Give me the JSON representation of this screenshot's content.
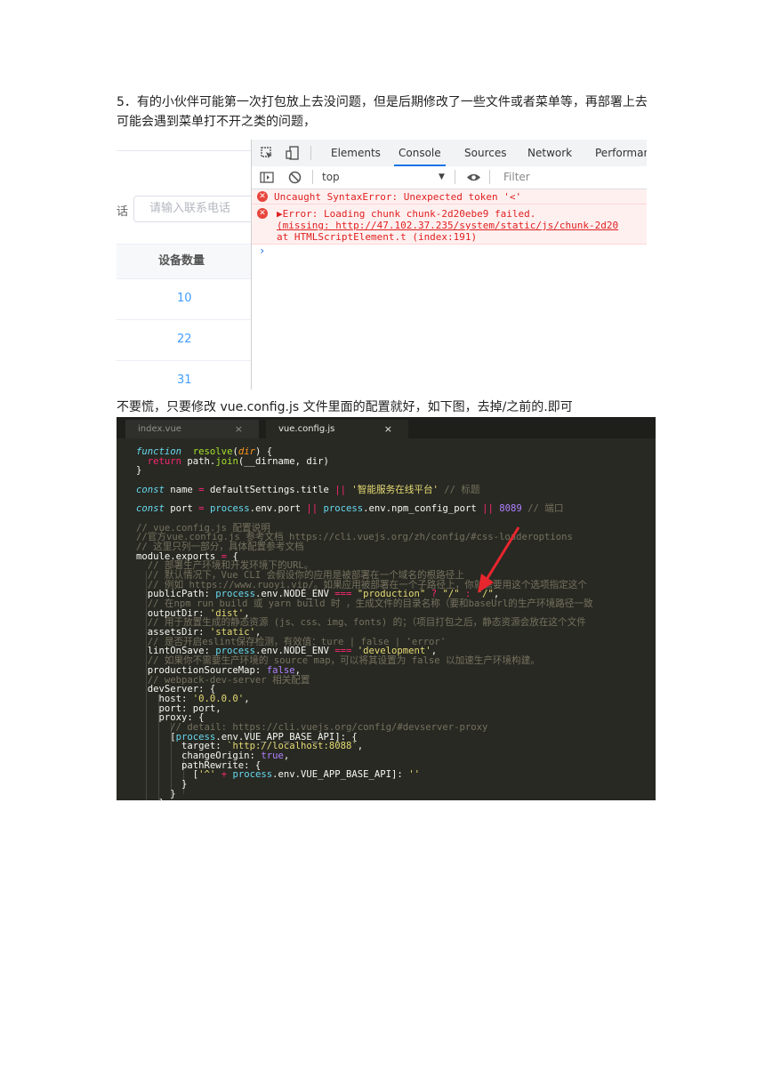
{
  "paragraphs": {
    "p1": "5．有的小伙伴可能第一次打包放上去没问题，但是后期修改了一些文件或者菜单等，再部署上去可能会遇到菜单打不开之类的问题，",
    "p2": "不要慌，只要修改 vue.config.js 文件里面的配置就好，如下图，去掉/之前的.即可"
  },
  "screenshot1": {
    "left_panel": {
      "cut_label_char": "话",
      "phone_input_placeholder": "请输入联系电话",
      "table_header": "设备数量",
      "rows": [
        "10",
        "22",
        "31"
      ]
    },
    "devtools": {
      "tabs": [
        "Elements",
        "Console",
        "Sources",
        "Network",
        "Performan"
      ],
      "active_tab": "Console",
      "context_select": "top",
      "filter_placeholder": "Filter",
      "errors": [
        {
          "lines": [
            "Uncaught SyntaxError: Unexpected token '<'"
          ]
        },
        {
          "lines": [
            "▶Error: Loading chunk chunk-2d20ebe9 failed.",
            "(missing: http://47.102.37.235/system/static/js/chunk-2d20",
            "    at HTMLScriptElement.t (index:191)"
          ]
        }
      ],
      "prompt": "›"
    }
  },
  "screenshot2": {
    "tabs": [
      {
        "name": "index.vue",
        "close": "×"
      },
      {
        "name": "vue.config.js",
        "close": "×"
      }
    ],
    "code_lines": [
      [
        [
          "kw",
          "function"
        ],
        [
          "",
          "  "
        ],
        [
          "fn",
          "resolve"
        ],
        [
          "",
          "("
        ],
        [
          "par",
          "dir"
        ],
        [
          "",
          ") {"
        ]
      ],
      [
        [
          "",
          "  "
        ],
        [
          "op",
          "return"
        ],
        [
          "",
          " path."
        ],
        [
          "fn",
          "join"
        ],
        [
          "",
          "(__dirname, dir)"
        ]
      ],
      [
        [
          "",
          "}"
        ]
      ],
      [
        [
          "",
          ""
        ]
      ],
      [
        [
          "kw",
          "const"
        ],
        [
          "",
          " name "
        ],
        [
          "op",
          "="
        ],
        [
          "",
          " defaultSettings.title "
        ],
        [
          "op",
          "||"
        ],
        [
          "str",
          " '智能服务在线平台'"
        ],
        [
          "cmt",
          " // 标题"
        ]
      ],
      [
        [
          "",
          ""
        ]
      ],
      [
        [
          "kw",
          "const"
        ],
        [
          "",
          " port "
        ],
        [
          "op",
          "="
        ],
        [
          "cyn",
          " process"
        ],
        [
          "",
          ".env.port "
        ],
        [
          "op",
          "||"
        ],
        [
          "cyn",
          " process"
        ],
        [
          "",
          ".env.npm_config_port "
        ],
        [
          "op",
          "||"
        ],
        [
          "num",
          " 8089"
        ],
        [
          "cmt",
          " // 端口"
        ]
      ],
      [
        [
          "",
          ""
        ]
      ],
      [
        [
          "cmt",
          "// vue.config.js 配置说明"
        ]
      ],
      [
        [
          "cmt",
          "//官方vue.config.js 参考文档 https://cli.vuejs.org/zh/config/#css-loaderoptions"
        ]
      ],
      [
        [
          "cmt",
          "// 这里只列一部分，具体配置参考文档"
        ]
      ],
      [
        [
          "",
          "module.exports "
        ],
        [
          "op",
          "="
        ],
        [
          "",
          " {"
        ]
      ],
      [
        [
          "cmt",
          "  // 部署生产环境和开发环境下的URL。"
        ]
      ],
      [
        [
          "cmt",
          "  // 默认情况下，Vue CLI 会假设你的应用是被部署在一个域名的根路径上"
        ]
      ],
      [
        [
          "cmt",
          "  // 例如 https://www.ruoyi.vip/。如果应用被部署在一个子路径上，你就需要用这个选项指定这个"
        ]
      ],
      [
        [
          "",
          "  publicPath: "
        ],
        [
          "cyn",
          "process"
        ],
        [
          "",
          ".env.NODE_ENV "
        ],
        [
          "op",
          "==="
        ],
        [
          "str",
          " \"production\""
        ],
        [
          "op",
          " ?"
        ],
        [
          "str",
          " \"/\""
        ],
        [
          "op",
          " :"
        ],
        [
          "str",
          " \"/\""
        ],
        [
          "",
          ","
        ]
      ],
      [
        [
          "cmt",
          "  // 在npm run build 或 yarn build 时 ，生成文件的目录名称（要和baseUrl的生产环境路径一致"
        ]
      ],
      [
        [
          "",
          "  outputDir: "
        ],
        [
          "str",
          "'dist'"
        ],
        [
          "",
          ","
        ]
      ],
      [
        [
          "cmt",
          "  // 用于放置生成的静态资源 (js、css、img、fonts) 的；（项目打包之后，静态资源会放在这个文件"
        ]
      ],
      [
        [
          "",
          "  assetsDir: "
        ],
        [
          "str",
          "'static'"
        ],
        [
          "",
          ","
        ]
      ],
      [
        [
          "cmt",
          "  // 是否开启eslint保存检测，有效值：ture | false | 'error'"
        ]
      ],
      [
        [
          "",
          "  lintOnSave: "
        ],
        [
          "cyn",
          "process"
        ],
        [
          "",
          ".env.NODE_ENV "
        ],
        [
          "op",
          "==="
        ],
        [
          "str",
          " 'development'"
        ],
        [
          "",
          ","
        ]
      ],
      [
        [
          "cmt",
          "  // 如果你不需要生产环境的 source map，可以将其设置为 false 以加速生产环境构建。"
        ]
      ],
      [
        [
          "",
          "  productionSourceMap: "
        ],
        [
          "num",
          "false"
        ],
        [
          "",
          ","
        ]
      ],
      [
        [
          "cmt",
          "  // webpack-dev-server 相关配置"
        ]
      ],
      [
        [
          "",
          "  devServer: {"
        ]
      ],
      [
        [
          "",
          "    host: "
        ],
        [
          "str",
          "'0.0.0.0'"
        ],
        [
          "",
          ","
        ]
      ],
      [
        [
          "",
          "    port: port,"
        ]
      ],
      [
        [
          "",
          "    proxy: {"
        ]
      ],
      [
        [
          "cmt",
          "      // detail: https://cli.vuejs.org/config/#devserver-proxy"
        ]
      ],
      [
        [
          "",
          "      ["
        ],
        [
          "cyn",
          "process"
        ],
        [
          "",
          ".env.VUE_APP_BASE_API]: {"
        ]
      ],
      [
        [
          "",
          "        target: "
        ],
        [
          "str",
          "`http://localhost:8088`"
        ],
        [
          "",
          ","
        ]
      ],
      [
        [
          "",
          "        changeOrigin: "
        ],
        [
          "num",
          "true"
        ],
        [
          "",
          ","
        ]
      ],
      [
        [
          "",
          "        pathRewrite: {"
        ]
      ],
      [
        [
          "",
          "          ["
        ],
        [
          "str",
          "'^'"
        ],
        [
          "op",
          " +"
        ],
        [
          "cyn",
          " process"
        ],
        [
          "",
          ".env.VUE_APP_BASE_API]: "
        ],
        [
          "str",
          "''"
        ]
      ],
      [
        [
          "",
          "        }"
        ]
      ],
      [
        [
          "",
          "      }"
        ]
      ],
      [
        [
          "",
          "    }"
        ]
      ]
    ]
  },
  "colors": {
    "editor_bg": "#282923",
    "error_text": "#e02020",
    "link_blue": "#409eff",
    "arrow_red": "#e8262e"
  }
}
